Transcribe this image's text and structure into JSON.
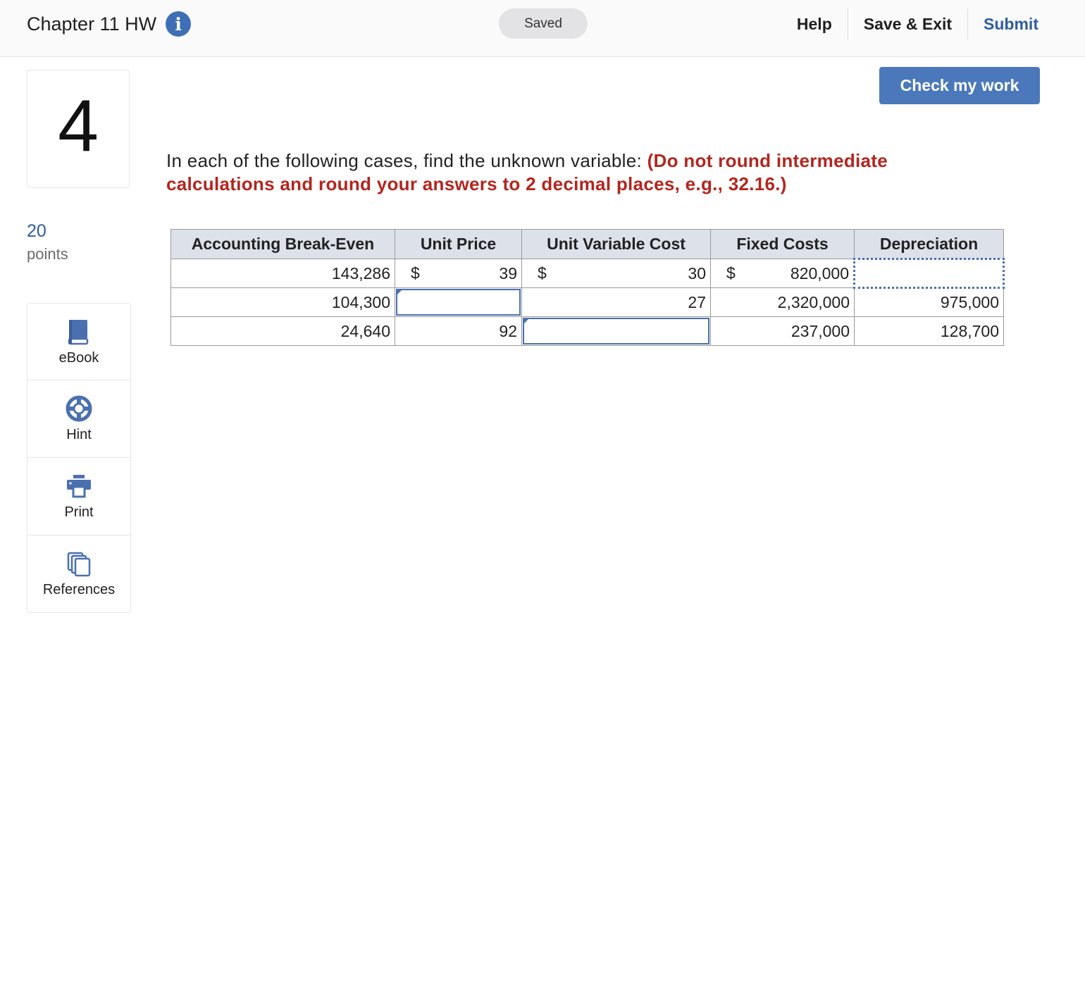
{
  "header": {
    "assignment_title": "Chapter 11 HW",
    "status": "Saved",
    "links": [
      "Help",
      "Save & Exit",
      "Submit"
    ]
  },
  "question": {
    "number": "4",
    "points_value": "20",
    "points_label": "points",
    "instruction": "In each of the following cases, find the unknown variable: ",
    "instruction_emphasis": "(Do not round intermediate calculations and round your answers to 2 decimal places, e.g., 32.16.)"
  },
  "tools": [
    "eBook",
    "Hint",
    "Print",
    "References"
  ],
  "check_button": "Check my work",
  "table": {
    "headers": [
      "Accounting Break-Even",
      "Unit Price",
      "Unit Variable Cost",
      "Fixed Costs",
      "Depreciation"
    ],
    "currency_symbol": "$",
    "rows": [
      {
        "break_even": "143,286",
        "unit_price": "39",
        "unit_variable_cost": "30",
        "fixed_costs": "820,000",
        "depreciation": ""
      },
      {
        "break_even": "104,300",
        "unit_price": "",
        "unit_variable_cost": "27",
        "fixed_costs": "2,320,000",
        "depreciation": "975,000"
      },
      {
        "break_even": "24,640",
        "unit_price": "92",
        "unit_variable_cost": "",
        "fixed_costs": "237,000",
        "depreciation": "128,700"
      }
    ]
  },
  "colors": {
    "accent_blue": "#4a78bb",
    "link_blue": "#2e5d9f",
    "emphasis_red": "#b3261e",
    "table_header_bg": "#dde1ea"
  }
}
